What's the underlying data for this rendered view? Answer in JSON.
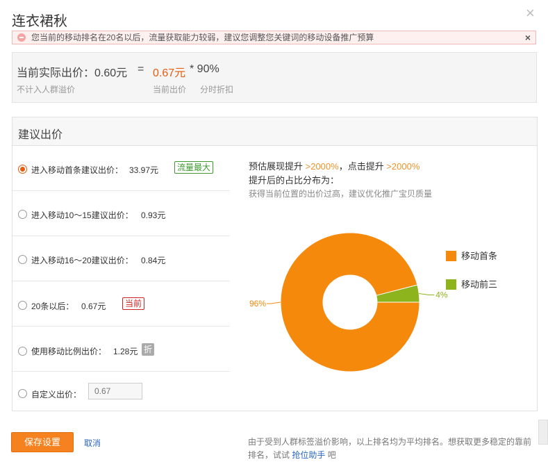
{
  "dialog": {
    "title": "连衣裙秋",
    "close_glyph": "×"
  },
  "warning": {
    "text": "您当前的移动排名在20名以后，流量获取能力较弱，建议您调整您关键词的移动设备推广预算",
    "close_glyph": "×"
  },
  "price_summary": {
    "actual_label": "当前实际出价：0.60元",
    "equals": "=",
    "current_price": "0.67元",
    "discount": "* 90%",
    "note_exclude": "不计入人群溢价",
    "current_price_label": "当前出价",
    "discount_label": "分时折扣"
  },
  "suggest": {
    "title": "建议出价",
    "options": [
      {
        "label": "进入移动首条建议出价：",
        "value": "33.97元",
        "tag": "流量最大",
        "checked": true
      },
      {
        "label": "进入移动10～15建议出价：",
        "value": "0.93元",
        "tag": "",
        "checked": false
      },
      {
        "label": "进入移动16～20建议出价：",
        "value": "0.84元",
        "tag": "",
        "checked": false
      },
      {
        "label": "20条以后：",
        "value": "0.67元",
        "tag": "当前",
        "checked": false
      },
      {
        "label": "使用移动比例出价：",
        "value": "1.28元",
        "tag": "折",
        "checked": false
      },
      {
        "label": "自定义出价：",
        "value": "",
        "tag": "",
        "checked": false
      }
    ],
    "custom_placeholder": "0.67"
  },
  "estimate": {
    "show_prefix": "预估展现提升 ",
    "show_value": ">2000%",
    "click_prefix": "，点击提升 ",
    "click_value": ">2000%",
    "distribution_label": "提升后的占比分布为：",
    "hint": "获得当前位置的出价过高，建议优化推广宝贝质量"
  },
  "chart_data": {
    "type": "pie",
    "donut": true,
    "categories": [
      "移动首条",
      "移动前三"
    ],
    "values": [
      96,
      4
    ],
    "data_labels": [
      "96%",
      "4%"
    ],
    "colors": [
      "#f5890c",
      "#8db41c"
    ],
    "legend": "right"
  },
  "footer": {
    "save_label": "保存设置",
    "cancel_label": "取消",
    "note_text": "由于受到人群标签溢价影响，以上排名均为平均排名。想获取更多稳定的靠前排名，试试 ",
    "note_link": "抢位助手",
    "note_suffix": " 吧"
  }
}
